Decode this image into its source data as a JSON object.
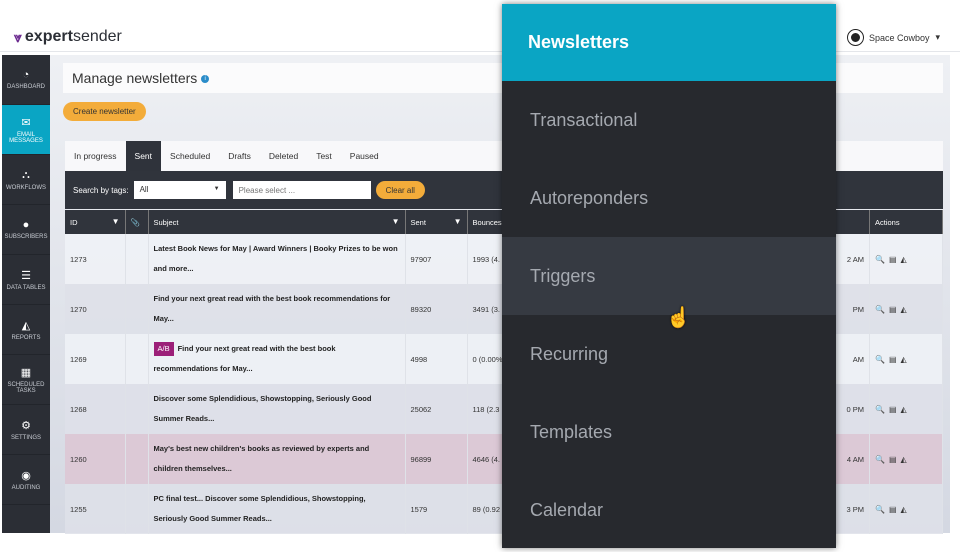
{
  "brand": {
    "name_bold": "expert",
    "name_rest": "sender"
  },
  "user": {
    "name": "Space Cowboy"
  },
  "sidebar": {
    "items": [
      {
        "label": "DASHBOARD",
        "icon": "gauge-icon"
      },
      {
        "label": "EMAIL MESSAGES",
        "icon": "envelope-icon",
        "active": true
      },
      {
        "label": "WORKFLOWS",
        "icon": "sitemap-icon"
      },
      {
        "label": "SUBSCRIBERS",
        "icon": "user-icon"
      },
      {
        "label": "DATA TABLES",
        "icon": "database-icon"
      },
      {
        "label": "REPORTS",
        "icon": "area-chart-icon"
      },
      {
        "label": "SCHEDULED TASKS",
        "icon": "calendar-icon"
      },
      {
        "label": "SETTINGS",
        "icon": "gears-icon"
      },
      {
        "label": "AUDITING",
        "icon": "eye-icon"
      }
    ]
  },
  "page": {
    "title": "Manage newsletters",
    "create_label": "Create newsletter"
  },
  "tabs": [
    "In progress",
    "Sent",
    "Scheduled",
    "Drafts",
    "Deleted",
    "Test",
    "Paused"
  ],
  "active_tab": "Sent",
  "filter": {
    "label": "Search by tags:",
    "select_value": "All",
    "placeholder": "Please select ...",
    "clear_label": "Clear all"
  },
  "table": {
    "headers": {
      "id": "ID",
      "subject": "Subject",
      "sent": "Sent",
      "bounces": "Bounces",
      "actions": "Actions"
    },
    "rows": [
      {
        "id": "1273",
        "subject": "Latest Book News for May | Award Winners | Booky Prizes to be won and more...",
        "sent": "97907",
        "bounces": "1993 (4.",
        "time": "2 AM"
      },
      {
        "id": "1270",
        "subject": "Find your next great read with the best book recommendations for May...",
        "sent": "89320",
        "bounces": "3491 (3.",
        "time": "PM"
      },
      {
        "id": "1269",
        "ab": "A/B",
        "subject": "Find your next great read with the best book recommendations for May...",
        "sent": "4998",
        "bounces": "0 (0.00%",
        "time": "AM"
      },
      {
        "id": "1268",
        "subject": "Discover some Splendidious, Showstopping, Seriously Good Summer Reads...",
        "sent": "25062",
        "bounces": "118 (2.3",
        "time": "0 PM"
      },
      {
        "id": "1260",
        "subject": "May's best new children's books as reviewed by experts and children themselves...",
        "sent": "96899",
        "bounces": "4646 (4.",
        "time": "4 AM",
        "highlight": true
      },
      {
        "id": "1255",
        "subject": "PC final test... Discover some Splendidious, Showstopping, Seriously Good Summer Reads...",
        "sent": "1579",
        "bounces": "89 (0.92",
        "time": "3 PM"
      }
    ]
  },
  "menu": {
    "header": "Newsletters",
    "items": [
      "Transactional",
      "Autoreponders",
      "Triggers",
      "Recurring",
      "Templates",
      "Calendar"
    ],
    "hovered": "Triggers"
  },
  "colors": {
    "accent": "#0aa5c4",
    "button": "#f3ac3a",
    "dark": "#2b2e35",
    "ab_badge": "#9c1f78"
  }
}
